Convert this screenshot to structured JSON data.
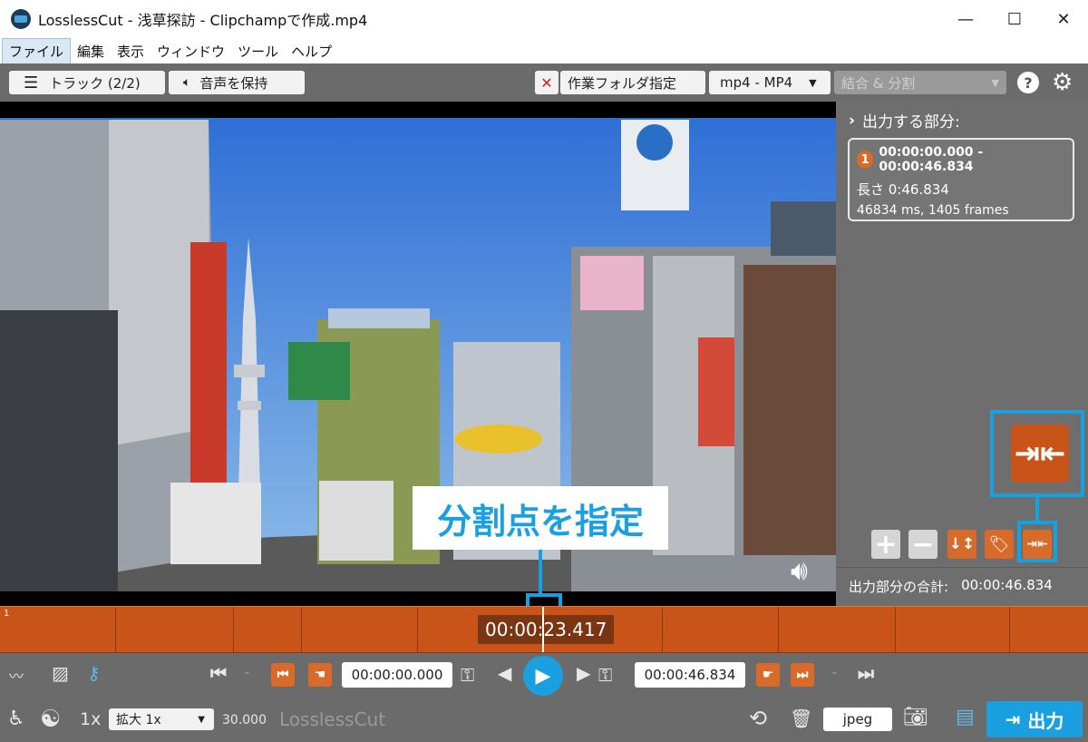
{
  "window": {
    "title": "LosslessCut - 浅草探訪  -  Clipchampで作成.mp4",
    "minimize": "—",
    "maximize": "☐",
    "close": "✕"
  },
  "menu": {
    "items": [
      "ファイル",
      "編集",
      "表示",
      "ウィンドウ",
      "ツール",
      "ヘルプ"
    ]
  },
  "toolbar": {
    "tracks_label": "トラック (2/2)",
    "audio_label": "音声を保持",
    "workdir_label": "作業フォルダ指定",
    "format_label": "mp4 - MP4",
    "mode_label": "結合 & 分割",
    "help": "?",
    "icons": [
      "menu-icon",
      "speaker-icon",
      "close-x-icon",
      "chevron-down-icon",
      "help-icon",
      "gear-icon"
    ]
  },
  "side": {
    "header": "出力する部分:",
    "segment": {
      "index": "1",
      "range": "00:00:00.000 - 00:00:46.834",
      "length": "長さ 0:46.834",
      "frames": "46834 ms, 1405 frames"
    },
    "total_label": "出力部分の合計:",
    "total_value": "00:00:46.834"
  },
  "timeline": {
    "segment_no": "1",
    "current_time": "00:00:23.417"
  },
  "annotation": {
    "label": "分割点を指定"
  },
  "controls": {
    "start_time": "00:00:00.000",
    "end_time": "00:00:46.834",
    "dash": "-",
    "speed": "1x",
    "zoom_label": "拡大 1x",
    "fps": "30.000",
    "brand": "LosslessCut",
    "capture_format": "jpeg",
    "export_label": "出力"
  },
  "colors": {
    "accent_orange": "#c9541a",
    "annotation_blue": "#1aa0e0",
    "panel_gray": "#6b6b6b"
  }
}
